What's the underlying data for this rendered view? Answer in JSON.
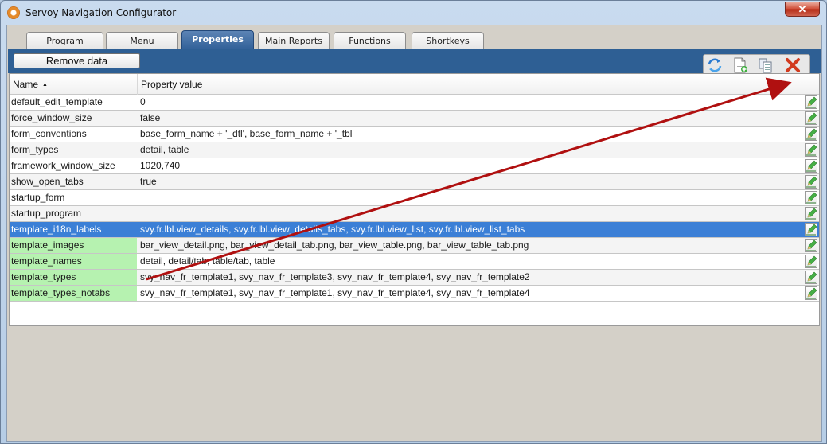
{
  "window": {
    "title": "Servoy Navigation Configurator",
    "close_glyph": "✕"
  },
  "tabs": [
    {
      "label": "Program"
    },
    {
      "label": "Menu"
    },
    {
      "label": "Properties"
    },
    {
      "label": "Main Reports"
    },
    {
      "label": "Functions"
    },
    {
      "label": "Shortkeys"
    }
  ],
  "active_tab": "Properties",
  "toolbar": {
    "remove_label": "Remove data",
    "icons": [
      "refresh-icon",
      "new-document-icon",
      "copy-document-icon",
      "delete-icon"
    ]
  },
  "table": {
    "columns": [
      {
        "label": "Name",
        "sort": "ascending"
      },
      {
        "label": "Property value"
      }
    ],
    "rows": [
      {
        "name": "default_edit_template",
        "value": "0"
      },
      {
        "name": "force_window_size",
        "value": "false"
      },
      {
        "name": "form_conventions",
        "value": "base_form_name + '_dtl', base_form_name + '_tbl'"
      },
      {
        "name": "form_types",
        "value": "detail, table"
      },
      {
        "name": "framework_window_size",
        "value": "1020,740"
      },
      {
        "name": "show_open_tabs",
        "value": "true"
      },
      {
        "name": "startup_form",
        "value": ""
      },
      {
        "name": "startup_program",
        "value": ""
      },
      {
        "name": "template_i18n_labels",
        "value": "svy.fr.lbl.view_details, svy.fr.lbl.view_details_tabs, svy.fr.lbl.view_list, svy.fr.lbl.view_list_tabs"
      },
      {
        "name": "template_images",
        "value": "bar_view_detail.png, bar_view_detail_tab.png, bar_view_table.png, bar_view_table_tab.png"
      },
      {
        "name": "template_names",
        "value": "detail, detail/tab, table/tab, table"
      },
      {
        "name": "template_types",
        "value": "svy_nav_fr_template1, svy_nav_fr_template3, svy_nav_fr_template4, svy_nav_fr_template2"
      },
      {
        "name": "template_types_notabs",
        "value": "svy_nav_fr_template1, svy_nav_fr_template1, svy_nav_fr_template4, svy_nav_fr_template4"
      }
    ],
    "selected_row": "template_i18n_labels",
    "highlighted_rows": [
      "template_i18n_labels",
      "template_images",
      "template_names",
      "template_types",
      "template_types_notabs"
    ]
  },
  "colors": {
    "toolbar": "#2e5f94",
    "selection": "#3b7fd6",
    "highlight": "#b6f2b0",
    "annotation_arrow": "#b01010"
  }
}
